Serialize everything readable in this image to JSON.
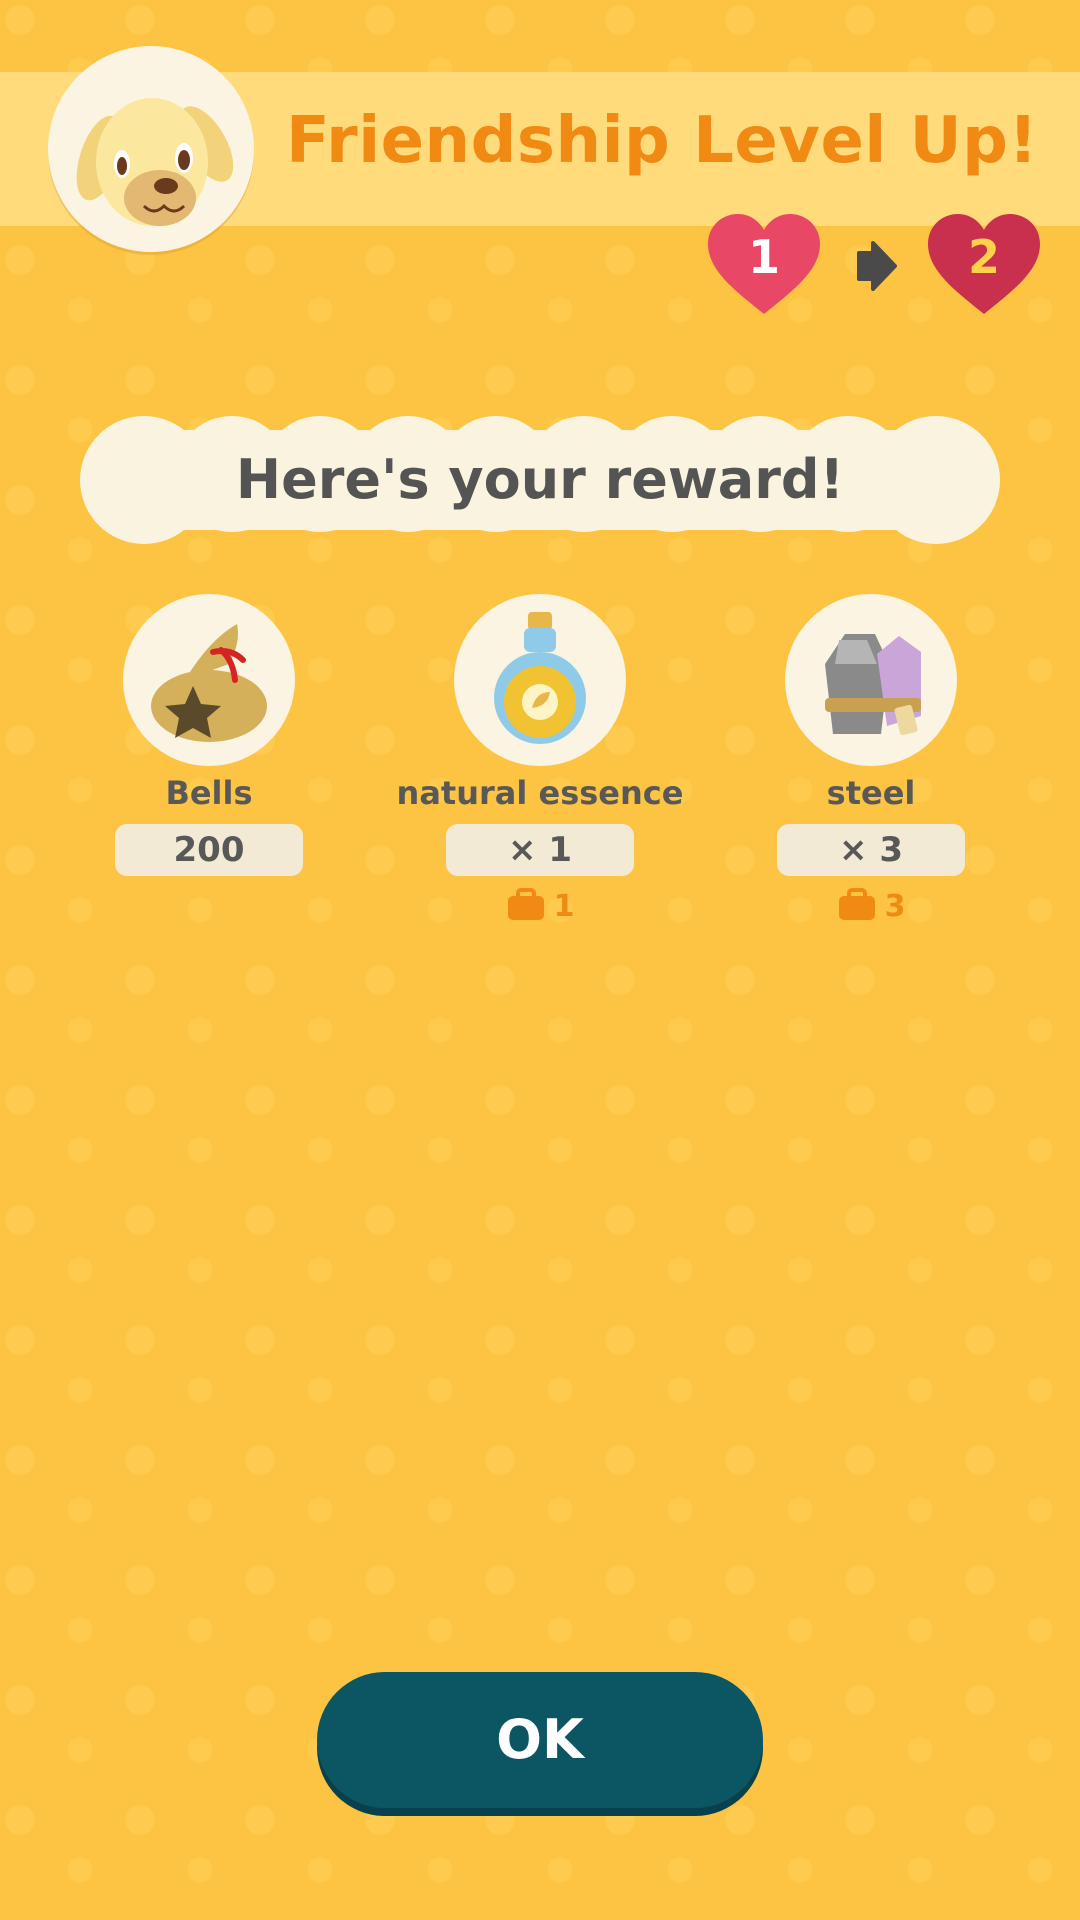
{
  "header": {
    "title": "Friendship Level Up!",
    "avatar": "dog-villager-avatar-icon"
  },
  "friendship": {
    "from_level": "1",
    "to_level": "2",
    "colors": {
      "from_heart": "#E84866",
      "to_heart": "#C9304E",
      "arrow": "#4A4A4A"
    }
  },
  "banner": {
    "text": "Here's your reward!"
  },
  "rewards": [
    {
      "name": "Bells",
      "quantity": "200",
      "icon": "bell-bag-icon"
    },
    {
      "name": "natural essence",
      "quantity": "× 1",
      "bag_count": "1",
      "icon": "essence-bottle-icon"
    },
    {
      "name": "steel",
      "quantity": "× 3",
      "bag_count": "3",
      "icon": "steel-ore-icon"
    }
  ],
  "ok_button": {
    "label": "OK"
  },
  "colors": {
    "background": "#FDC444",
    "title": "#F08A12",
    "button": "#0C5663"
  }
}
